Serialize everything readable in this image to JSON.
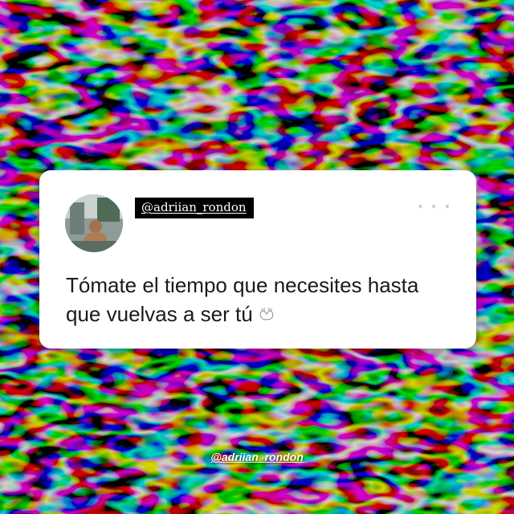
{
  "background": {
    "description_icon": "water-caustics",
    "colors": {
      "dark": "#0d0d0d",
      "light": "#e8e8e8"
    }
  },
  "card": {
    "handle": "@adriian_rondon",
    "text_line1": "Tómate el tiempo que necesites hasta",
    "text_line2": "que vuelvas a ser tú",
    "emoji_icon": "hugging-hands-icon",
    "more_icon": "more-dots-icon"
  },
  "watermark": {
    "text": "@adriian_rondon"
  }
}
